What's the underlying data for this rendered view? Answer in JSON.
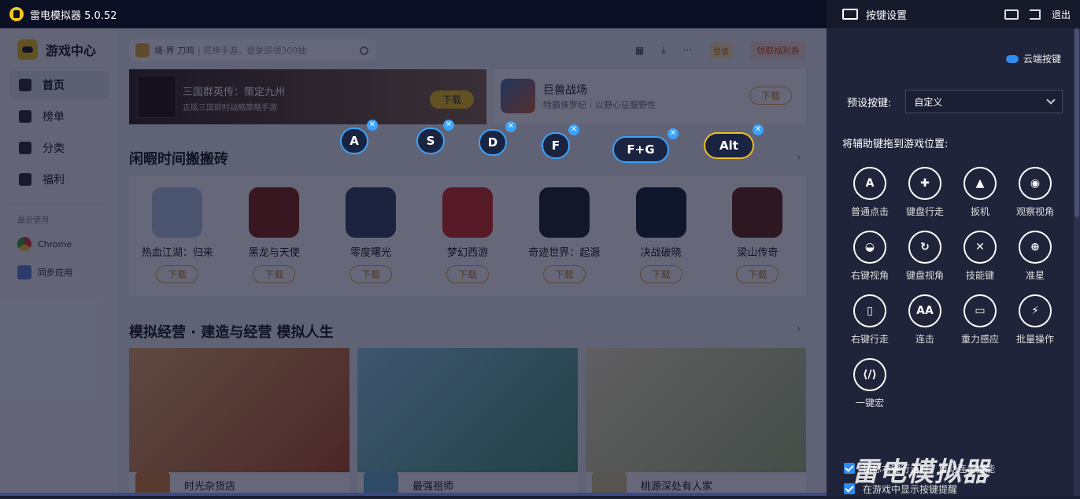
{
  "window": {
    "title": "雷电模拟器 5.0.52"
  },
  "sidebar": {
    "brand": "游戏中心",
    "items": [
      {
        "label": "首页",
        "active": true,
        "icon": "gamepad-icon"
      },
      {
        "label": "榜单",
        "icon": "bar-chart-icon"
      },
      {
        "label": "分类",
        "icon": "grid-icon"
      },
      {
        "label": "福利",
        "icon": "gift-icon"
      }
    ],
    "recent_title": "最近使用",
    "recent": [
      {
        "label": "Chrome",
        "icon": "chrome-icon"
      },
      {
        "label": "同步应用",
        "icon": "sync-app-icon"
      }
    ]
  },
  "topbar": {
    "search_prefix": "境·界 刀鸣",
    "search_hint": "| 死神手游，登录即领300抽",
    "login": "登录",
    "welfare": "领取福利券"
  },
  "banner": {
    "title": "三国群英传：策定九州",
    "subtitle": "正版三国即时战略策略手游",
    "button": "下载"
  },
  "promo": {
    "title": "巨兽战场",
    "subtitle": "特霸侏罗纪｜以野心征服野性",
    "button": "下载"
  },
  "section1": {
    "title": "闲暇时间搬搬砖",
    "games": [
      {
        "name": "热血江湖：归来",
        "download": "下载",
        "color": "#b7cde8"
      },
      {
        "name": "黑龙与天使",
        "download": "下载",
        "color": "#8a2a1a"
      },
      {
        "name": "零度曙光",
        "download": "下载",
        "color": "#3a4a66"
      },
      {
        "name": "梦幻西游",
        "download": "下载",
        "color": "#d8352a"
      },
      {
        "name": "奇迹世界：起源",
        "download": "下载",
        "color": "#222a30"
      },
      {
        "name": "决战破晓",
        "download": "下载",
        "color": "#1e2a38"
      },
      {
        "name": "梁山传奇",
        "download": "下载",
        "color": "#6a2a1a"
      }
    ]
  },
  "section2": {
    "title": "模拟经营 · 建造与经营 模拟人生",
    "cards": [
      {
        "name": "时光杂货店",
        "color": "#d98a3a"
      },
      {
        "name": "最强祖师",
        "color": "#6ab0d0"
      },
      {
        "name": "桃源深处有人家",
        "color": "#d8c890"
      }
    ]
  },
  "keys": [
    "A",
    "S",
    "D",
    "F",
    "F+G",
    "Alt"
  ],
  "panel": {
    "title": "按键设置",
    "exit": "退出",
    "cloud": "云端按键",
    "preset_label": "预设按键:",
    "preset_value": "自定义",
    "drag_hint": "将辅助键拖到游戏位置:",
    "tools": [
      {
        "glyph": "A",
        "label": "普通点击",
        "icon": "tap-a-icon"
      },
      {
        "glyph": "✚",
        "label": "键盘行走",
        "icon": "dpad-icon"
      },
      {
        "glyph": "▲",
        "label": "扳机",
        "icon": "trigger-icon"
      },
      {
        "glyph": "◉",
        "label": "观察视角",
        "icon": "eye-icon"
      },
      {
        "glyph": "◒",
        "label": "右键视角",
        "icon": "right-view-icon"
      },
      {
        "glyph": "↻",
        "label": "键盘视角",
        "icon": "keyboard-view-icon"
      },
      {
        "glyph": "✕",
        "label": "技能键",
        "icon": "skill-icon"
      },
      {
        "glyph": "⊕",
        "label": "准星",
        "icon": "crosshair-icon"
      },
      {
        "glyph": "▯",
        "label": "右键行走",
        "icon": "mouse-icon"
      },
      {
        "glyph": "AA",
        "label": "连击",
        "icon": "combo-icon"
      },
      {
        "glyph": "▭",
        "label": "重力感应",
        "icon": "gravity-icon"
      },
      {
        "glyph": "⚡",
        "label": "批量操作",
        "icon": "batch-icon"
      },
      {
        "glyph": "⟨/⟩",
        "label": "一键宏",
        "icon": "macro-icon"
      }
    ],
    "checks": [
      "鼠标右键行走时，自动连击技能",
      "在游戏中显示按键提醒"
    ],
    "watermark": "雷电模拟器"
  }
}
